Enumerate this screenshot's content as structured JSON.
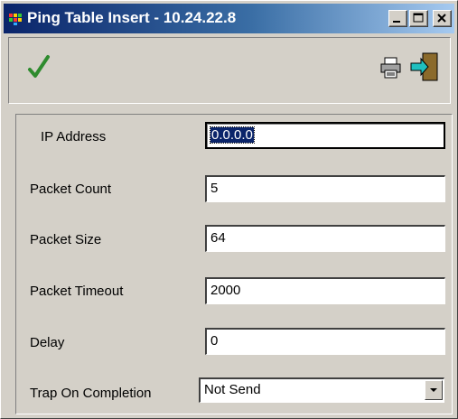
{
  "window": {
    "title": "Ping Table Insert - 10.24.22.8"
  },
  "titlebar_buttons": {
    "minimize": "minimize-icon",
    "maximize": "maximize-icon",
    "close": "close-icon"
  },
  "toolbar": {
    "confirm_icon": "checkmark-icon",
    "print_icon": "printer-icon",
    "exit_icon": "exit-door-icon"
  },
  "form": {
    "ip_address": {
      "label": "IP Address",
      "value": "0.0.0.0"
    },
    "packet_count": {
      "label": "Packet Count",
      "value": "5"
    },
    "packet_size": {
      "label": "Packet Size",
      "value": "64"
    },
    "packet_timeout": {
      "label": "Packet Timeout",
      "value": "2000"
    },
    "delay": {
      "label": "Delay",
      "value": "0"
    },
    "trap_on_completion": {
      "label": "Trap On Completion",
      "value": "Not Send"
    }
  },
  "colors": {
    "titlebar_start": "#0a246a",
    "titlebar_end": "#a6caf0",
    "face": "#d4d0c8",
    "checkmark": "#2e8b2e"
  }
}
